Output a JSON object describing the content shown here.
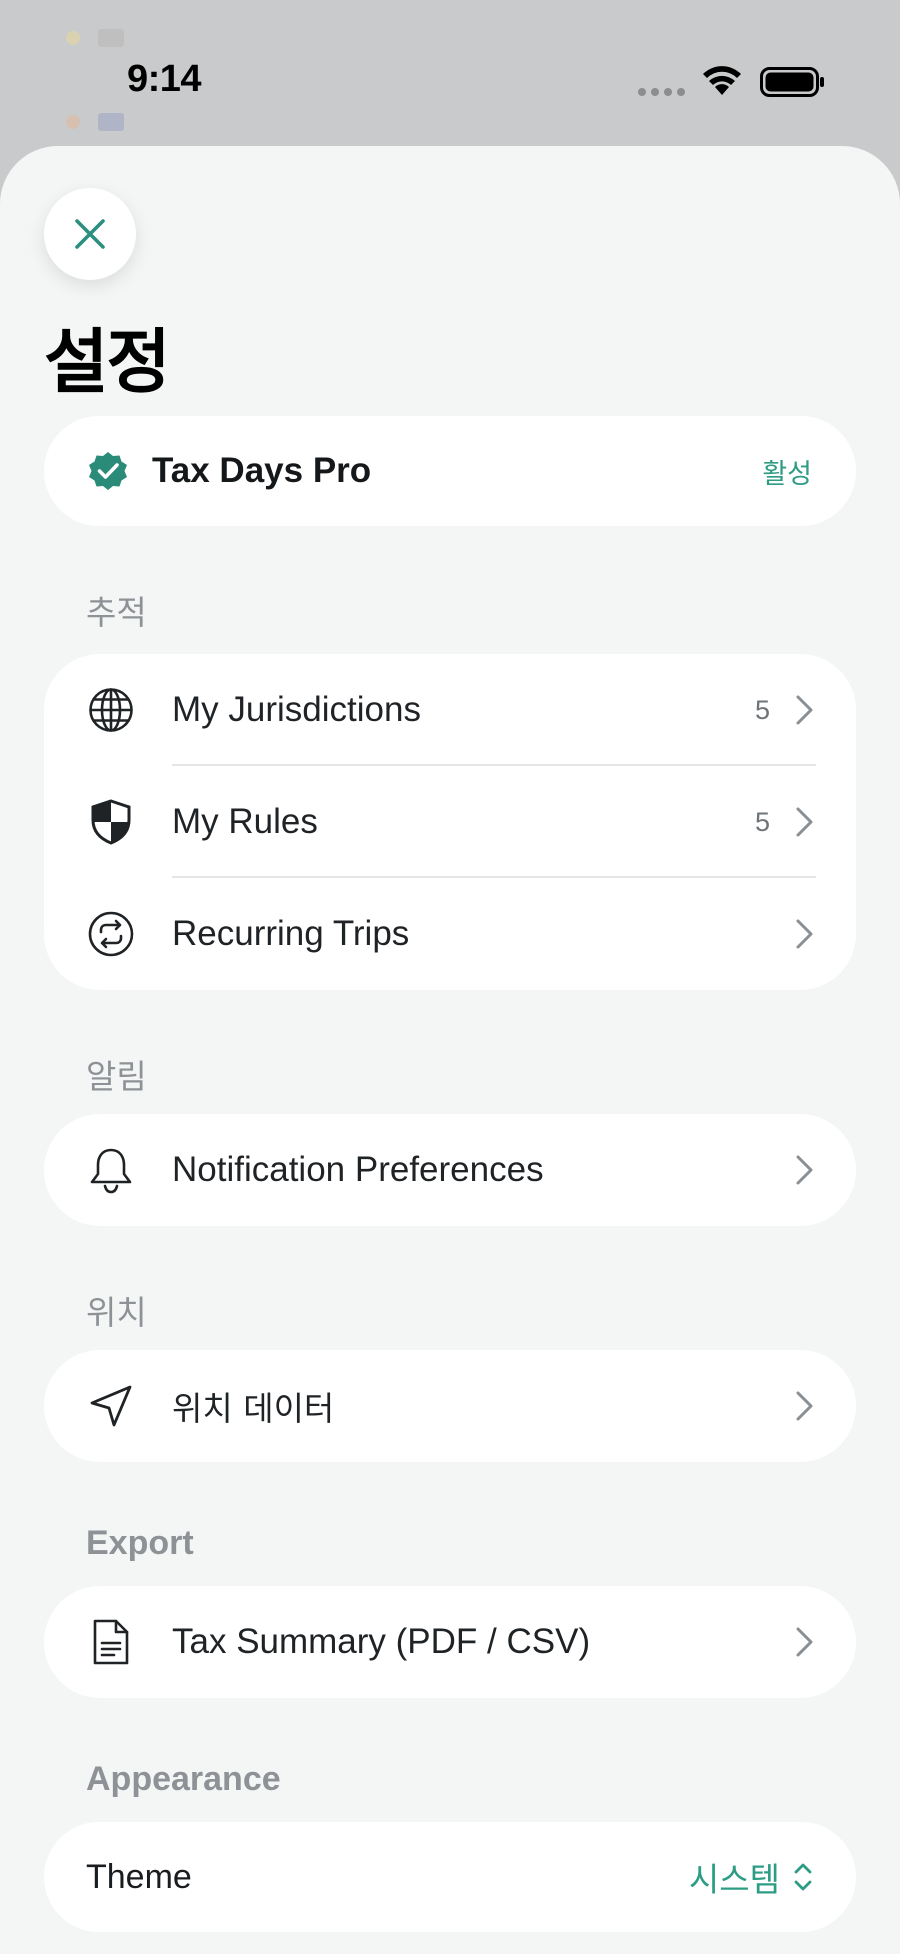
{
  "status_bar": {
    "time": "9:14"
  },
  "background": {
    "rows": [
      {
        "text": "",
        "value": ""
      },
      {
        "text": "",
        "value": ""
      }
    ]
  },
  "sheet": {
    "title": "설정",
    "pro": {
      "name": "Tax Days Pro",
      "status": "활성"
    },
    "sections": {
      "tracking": {
        "label": "추적",
        "items": [
          {
            "label": "My Jurisdictions",
            "count": "5",
            "icon": "globe-icon"
          },
          {
            "label": "My Rules",
            "count": "5",
            "icon": "shield-icon"
          },
          {
            "label": "Recurring Trips",
            "count": "",
            "icon": "repeat-icon"
          }
        ]
      },
      "alerts": {
        "label": "알림",
        "items": [
          {
            "label": "Notification Preferences",
            "icon": "bell-icon"
          }
        ]
      },
      "location": {
        "label": "위치",
        "items": [
          {
            "label": "위치 데이터",
            "icon": "location-arrow-icon"
          }
        ]
      },
      "export": {
        "label": "Export",
        "items": [
          {
            "label": "Tax Summary (PDF / CSV)",
            "icon": "document-icon"
          }
        ]
      },
      "appearance": {
        "label": "Appearance",
        "theme_label": "Theme",
        "theme_value": "시스템"
      }
    }
  },
  "colors": {
    "accent": "#2d9c84",
    "sheet_bg": "#f4f6f6",
    "card_bg": "#ffffff"
  }
}
